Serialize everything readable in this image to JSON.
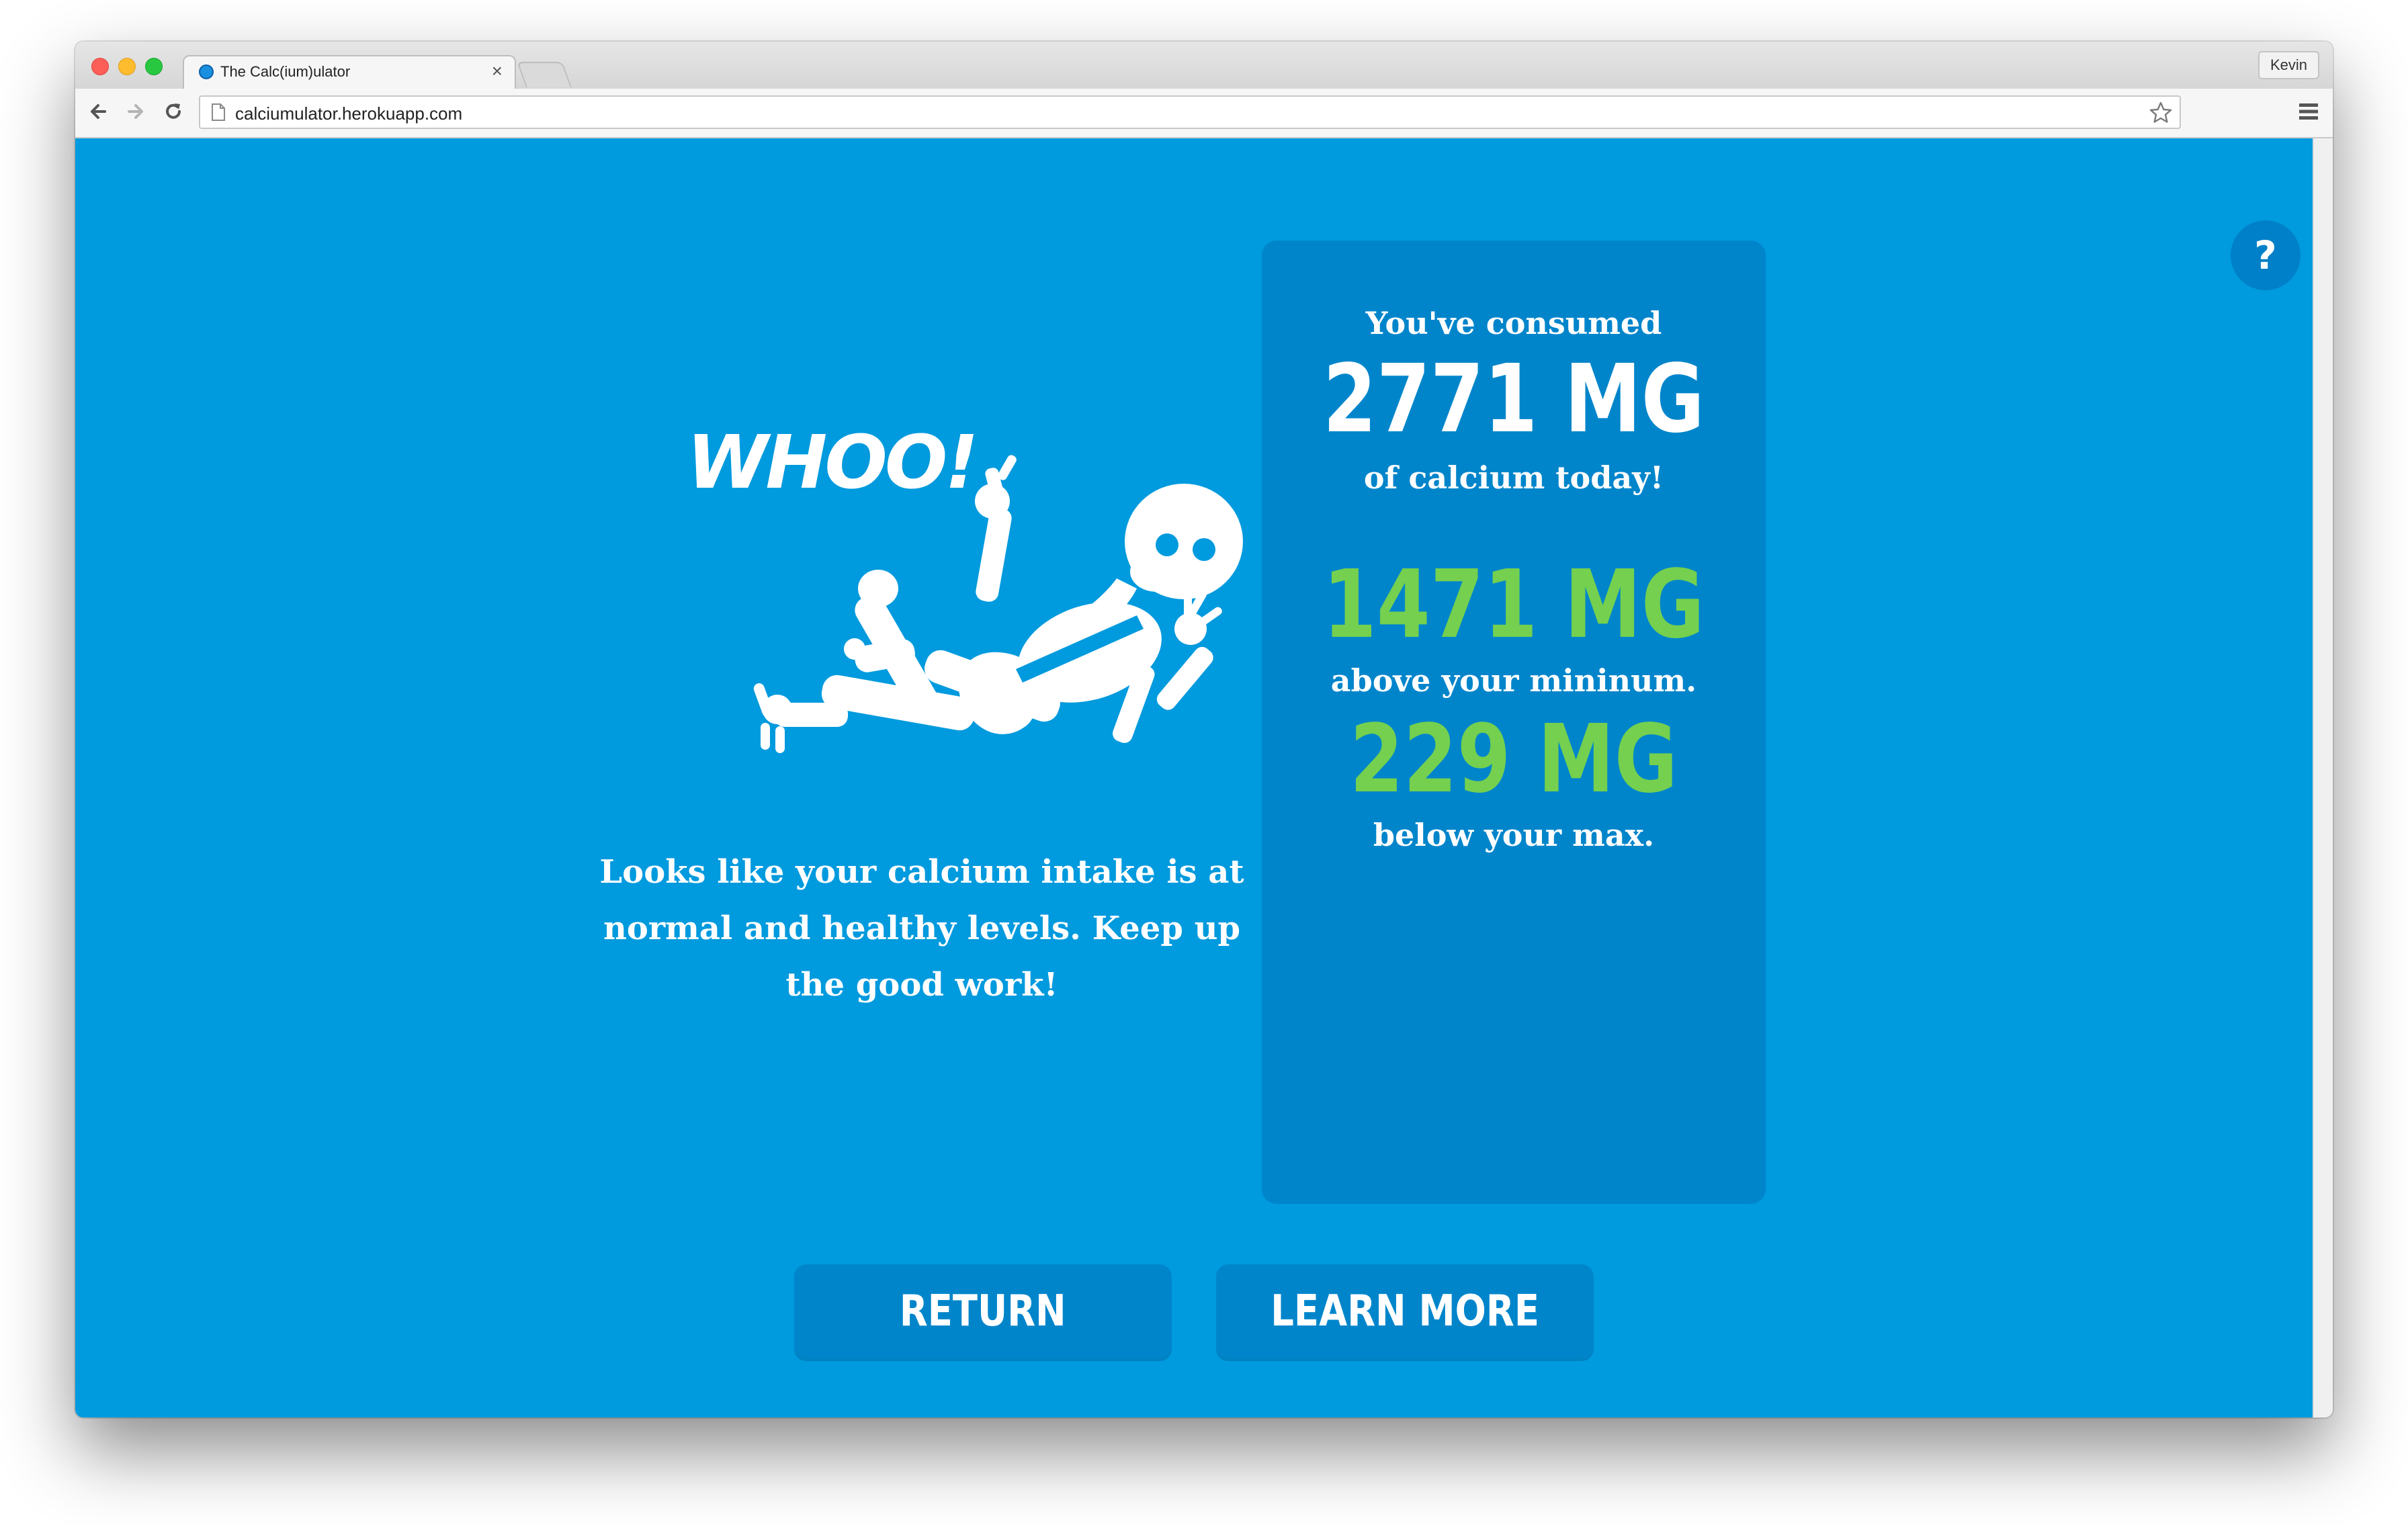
{
  "browser": {
    "tab_title": "The Calc(ium)ulator",
    "tab_close": "×",
    "url": "calciumulator.herokuapp.com",
    "profile_name": "Kevin"
  },
  "page": {
    "help_label": "?",
    "illustration_caption": "WHOO!",
    "message": "Looks like your calcium intake is at normal and healthy levels. Keep up the good work!",
    "stats": {
      "consumed_intro": "You've consumed",
      "consumed_amount": "2771 MG",
      "consumed_outro": "of calcium today!",
      "above_amount": "1471 MG",
      "above_label": "above your mininum.",
      "below_amount": "229 MG",
      "below_label": "below your max."
    },
    "buttons": {
      "return_label": "RETURN",
      "learn_more_label": "LEARN MORE"
    }
  },
  "colors": {
    "background": "#009ade",
    "panel": "#0085cb",
    "accent_green": "#74d04e",
    "text": "#ffffff"
  },
  "icons": [
    "back-icon",
    "forward-icon",
    "reload-icon",
    "page-icon",
    "star-icon",
    "menu-icon",
    "help-icon",
    "skeleton-illustration"
  ]
}
